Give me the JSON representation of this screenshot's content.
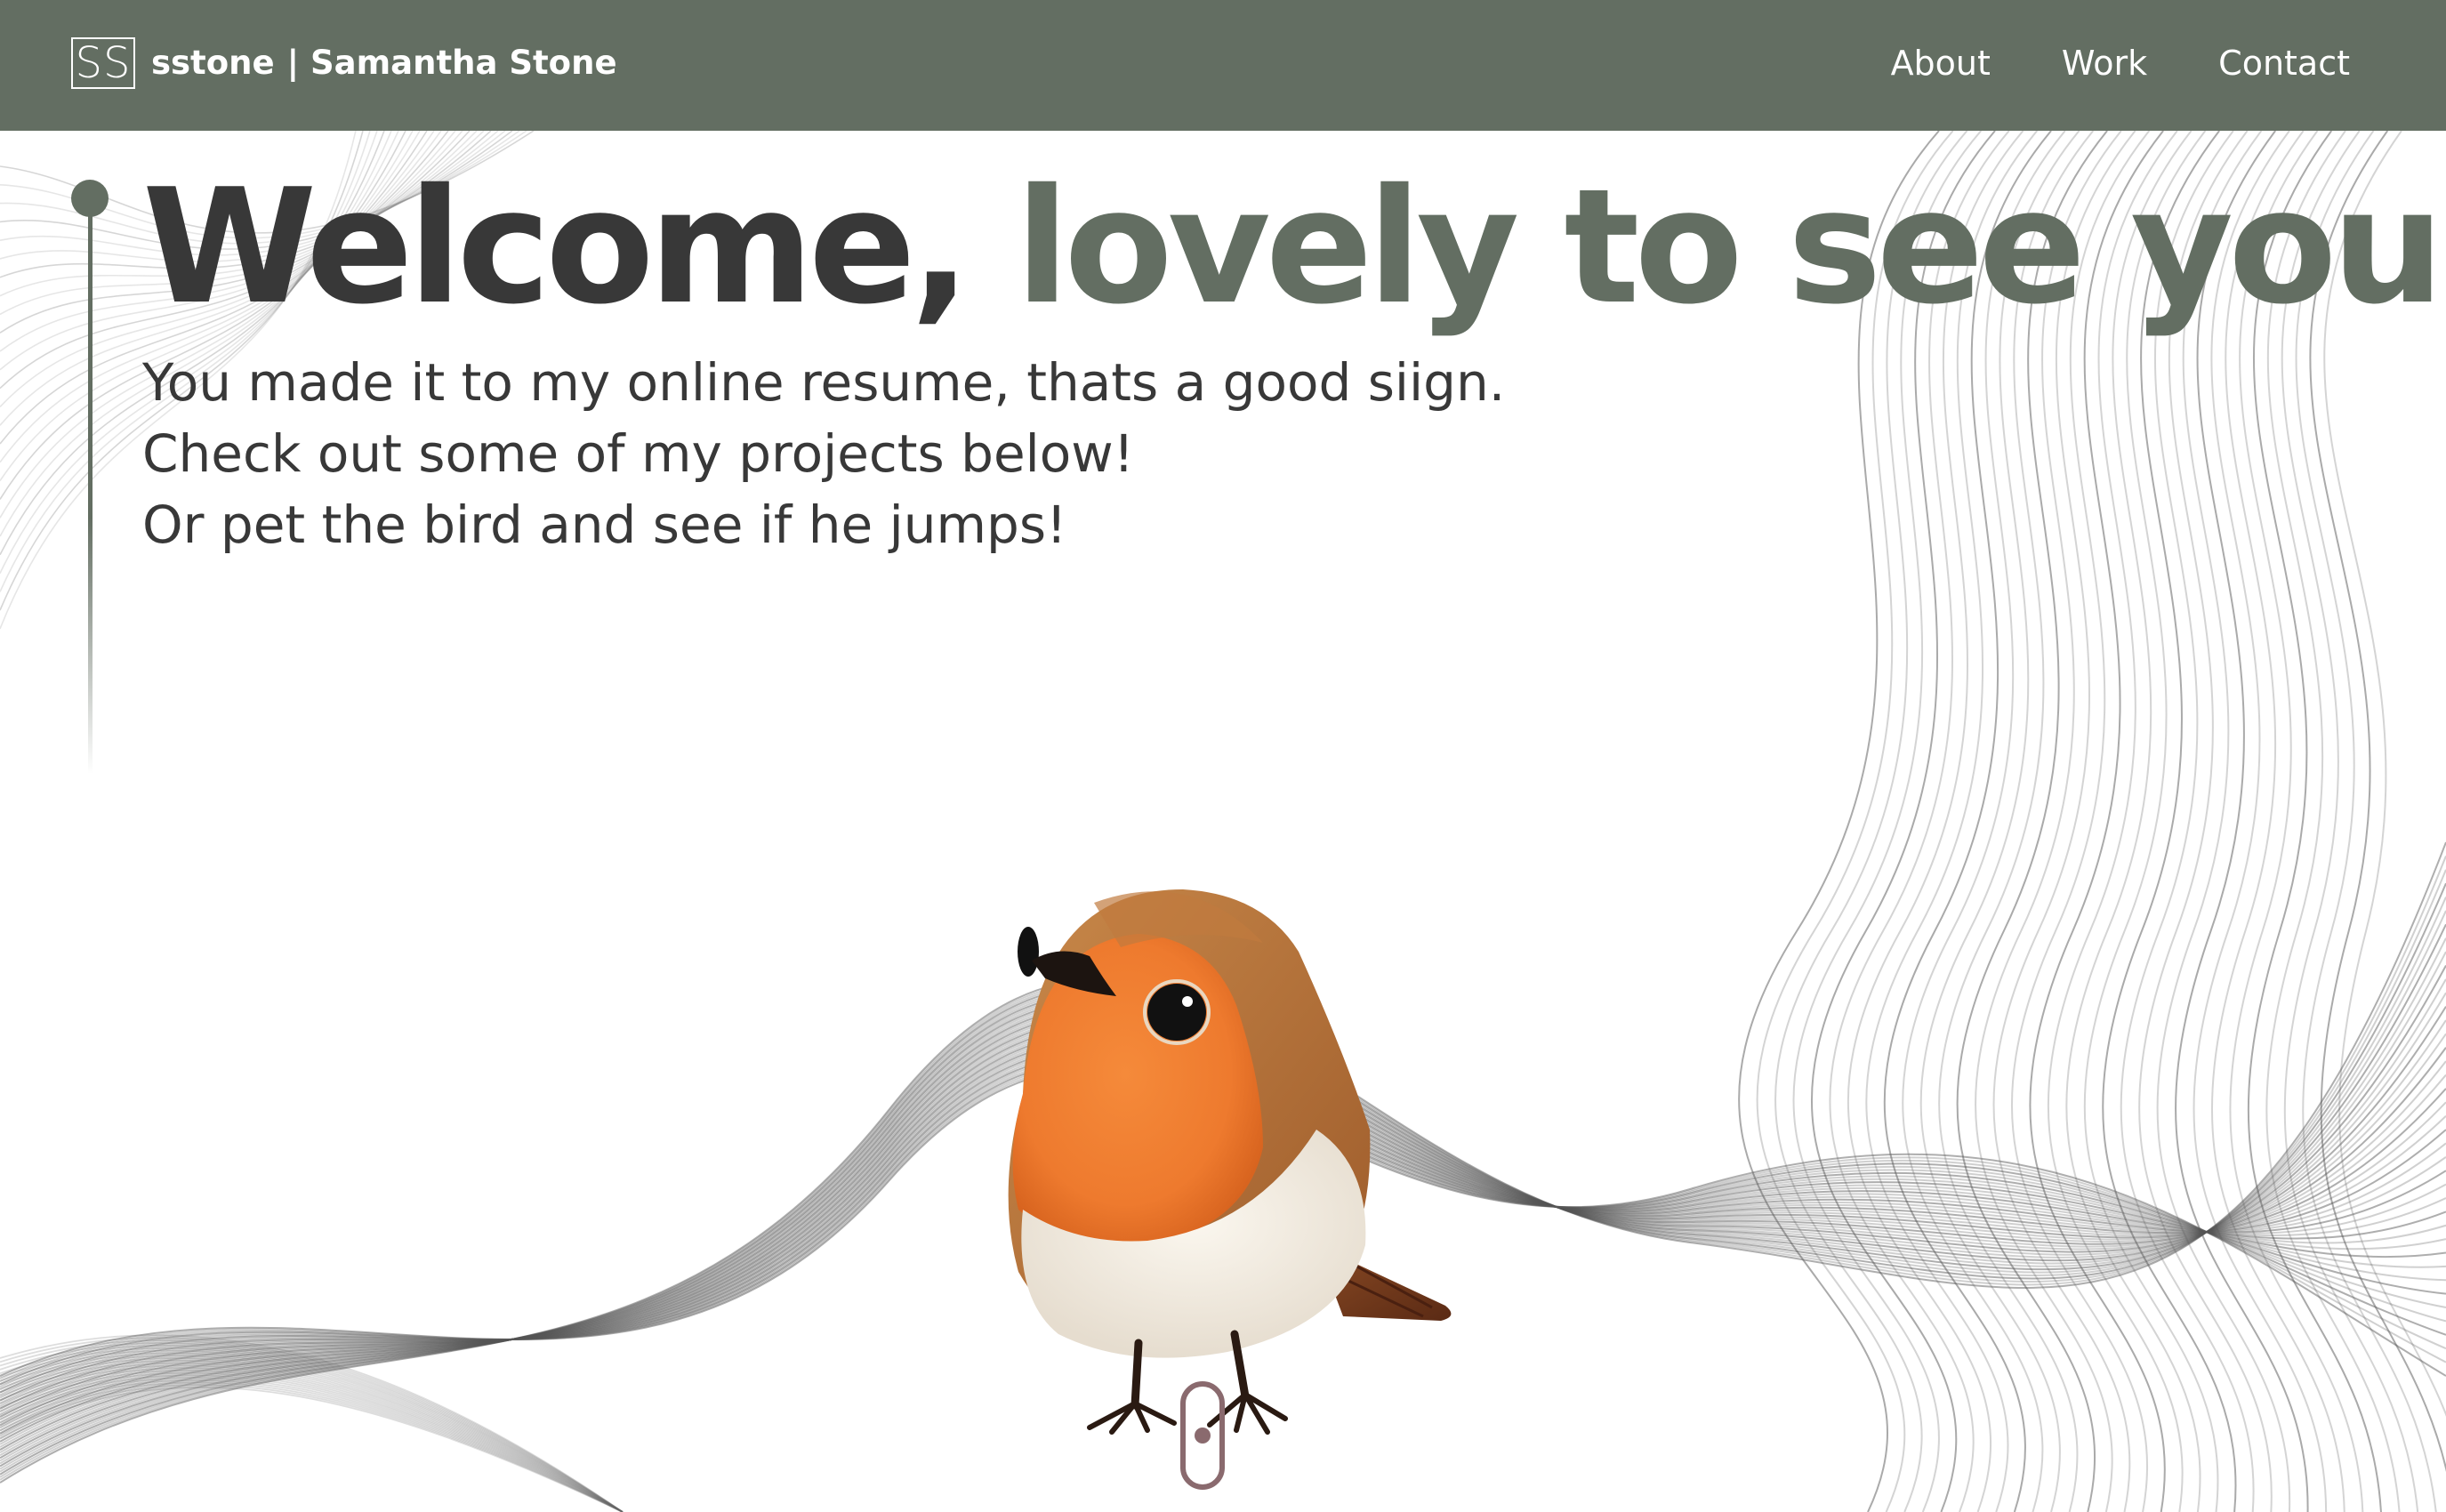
{
  "header": {
    "logo_text": "SS",
    "brand_name": "sstone",
    "brand_full": "| Samantha Stone",
    "nav": [
      {
        "label": "About"
      },
      {
        "label": "Work"
      },
      {
        "label": "Contact"
      }
    ]
  },
  "hero": {
    "headline_part1": "Welcome,",
    "headline_part2": "lovely to see you!",
    "lines": [
      "You made it to my online resume, thats a good siign.",
      "Check out some of my projects below!",
      "Or pet the bird and see if he jumps!"
    ]
  },
  "colors": {
    "accent": "#636e62",
    "text_dark": "#383838",
    "background": "#ffffff",
    "bird_breast": "#f07a2c",
    "scroll_indicator": "#8a6a6e"
  },
  "icons": {
    "logo": "ss-monogram-icon",
    "bird": "robin-bird-icon",
    "scroll": "scroll-mouse-icon"
  }
}
